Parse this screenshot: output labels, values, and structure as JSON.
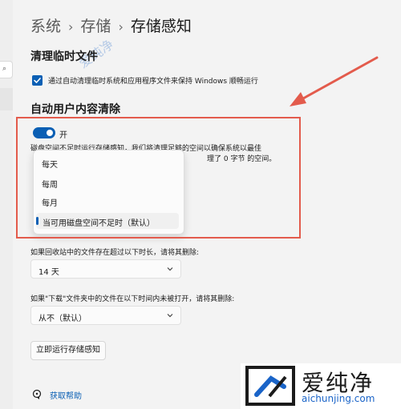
{
  "breadcrumb": {
    "items": [
      "系统",
      "存储"
    ],
    "current": "存储感知",
    "separator": "›"
  },
  "temp_files": {
    "title": "清理临时文件",
    "checkbox_label": "通过自动清理临时系统和应用程序文件来保持 Windows 顺畅运行",
    "checked": true
  },
  "auto_cleanup": {
    "title": "自动用户内容清除",
    "toggle_state": "开",
    "toggle_on": true,
    "description_line1": "磁盘空间不足时运行存储感知，我们将清理足够的空间以确保系统以最佳",
    "description_line2": "理了 0 字节 的空间。"
  },
  "run_dropdown": {
    "options": [
      "每天",
      "每周",
      "每月",
      "当可用磁盘空间不足时（默认）"
    ],
    "selected_index": 3
  },
  "recycle_bin": {
    "label": "如果回收站中的文件存在超过以下时长，请将其删除:",
    "value": "14 天"
  },
  "downloads": {
    "label": "如果\"下载\"文件夹中的文件在以下时间内未被打开，请将其删除:",
    "value": "从不（默认）"
  },
  "run_now_button": "立即运行存储感知",
  "help_link": "获取帮助",
  "watermark": {
    "name": "爱纯净",
    "url": "aichunjing.com",
    "faint": "爱纯净"
  },
  "colors": {
    "accent": "#0a5fb4",
    "highlight": "#e35b4c"
  }
}
